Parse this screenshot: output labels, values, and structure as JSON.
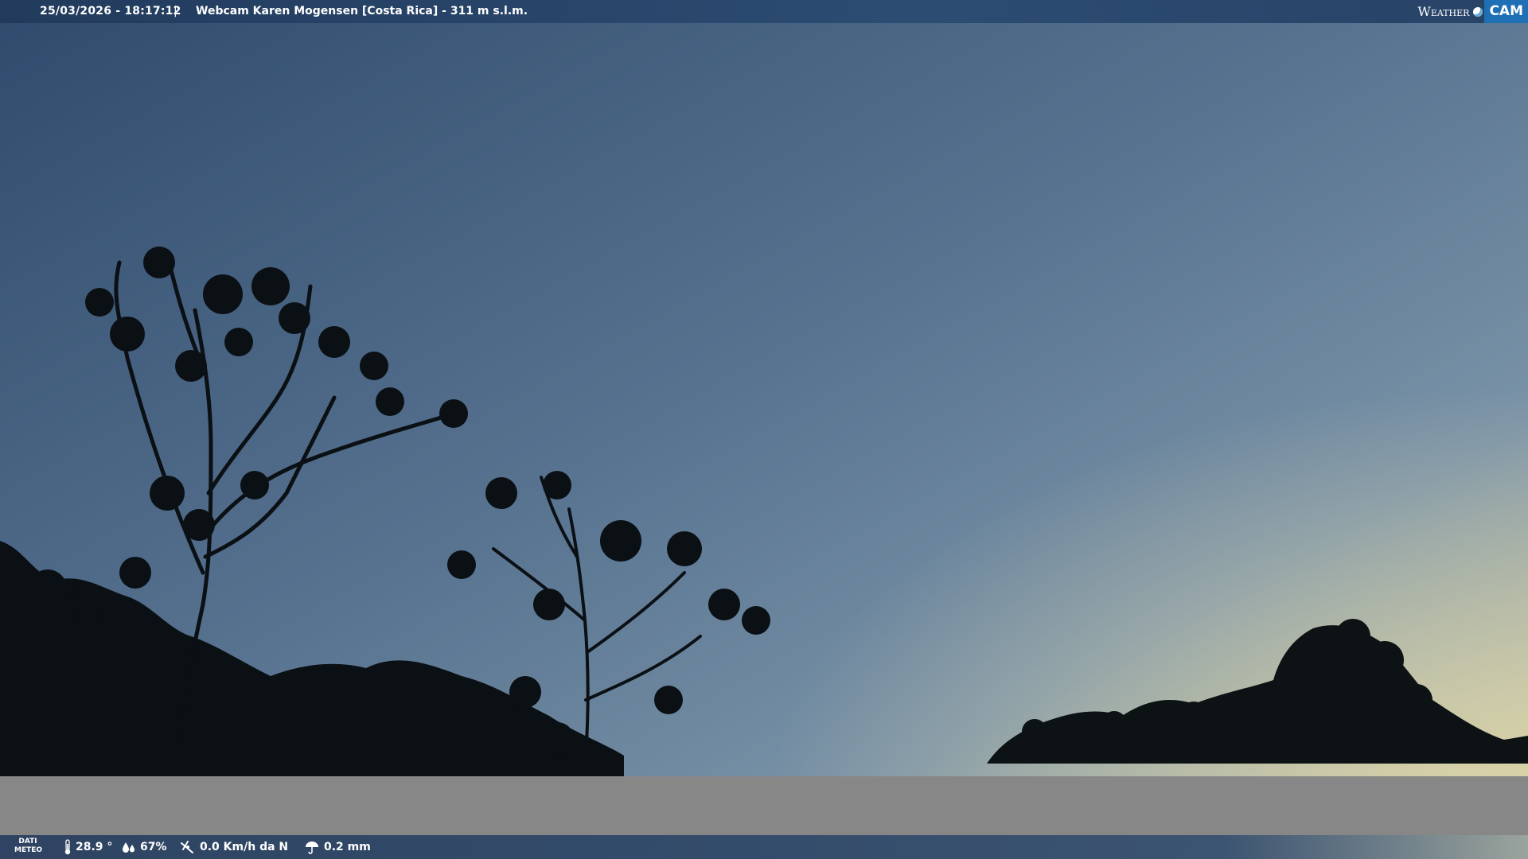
{
  "header": {
    "timestamp": "25/03/2026 - 18:17:12",
    "separator": "|",
    "title": "Webcam Karen Mogensen [Costa Rica]  - 311 m s.l.m."
  },
  "logo": {
    "weather": "Weather",
    "cam": "CAM"
  },
  "weather_bar": {
    "label_line1": "DATI",
    "label_line2": "METEO",
    "temperature": "28.9 °",
    "humidity": "67%",
    "wind": "0.0 Km/h da N",
    "rain": "0.2 mm"
  },
  "icons": {
    "temperature": "thermometer-icon",
    "humidity": "humidity-drops-icon",
    "wind": "wind-icon",
    "rain": "rain-umbrella-icon"
  },
  "colors": {
    "sky_top": "#3d5a7c",
    "sky_horizon": "#c9c6a0",
    "tree_silhouette": "#0b1014",
    "gray_band": "#878787"
  }
}
